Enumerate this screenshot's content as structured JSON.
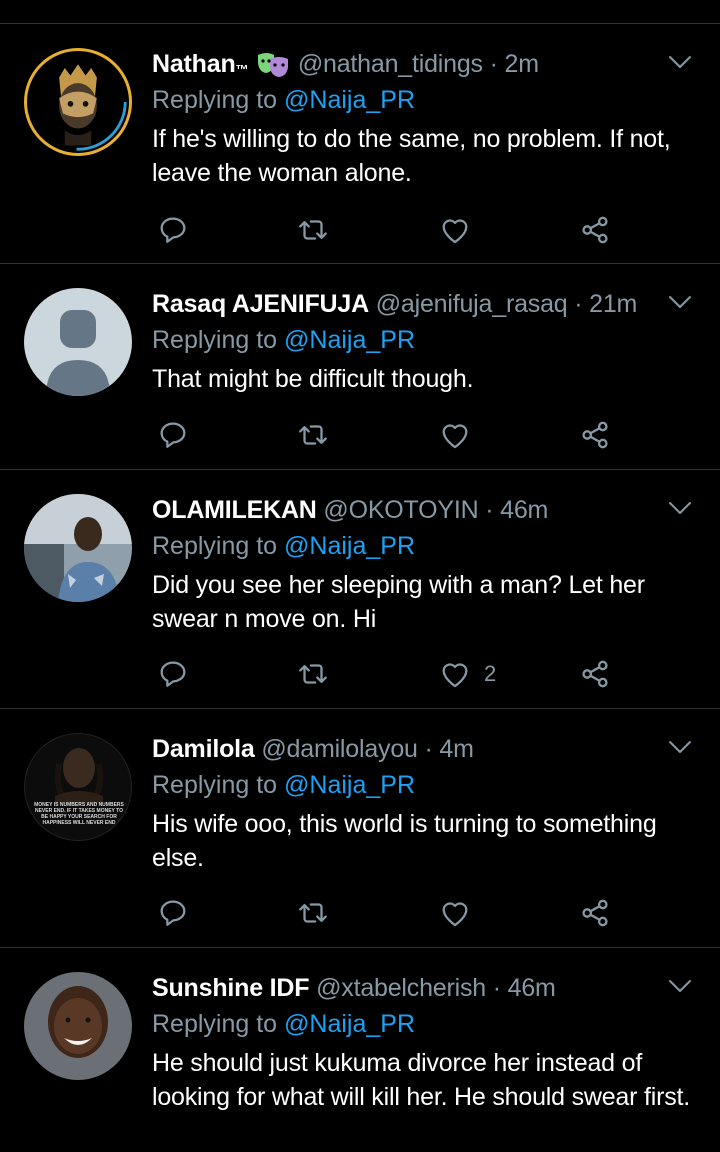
{
  "colors": {
    "background": "#000000",
    "muted": "#8899a6",
    "link": "#1da1f2",
    "divider": "#2f3336"
  },
  "tweets": [
    {
      "name": "Nathan",
      "trademark": "™",
      "emoji": "drama-masks-emoji",
      "handle": "@nathan_tidings",
      "sep": " · ",
      "time": "2m",
      "replying_prefix": "Replying to ",
      "replying_handle": "@Naija_PR",
      "text": "If he's willing to do the same, no problem. If not, leave the woman alone.",
      "likes": "",
      "avatar": "tiger-mask-portrait"
    },
    {
      "name": "Rasaq AJENIFUJA",
      "handle": "@ajenifuja_rasaq",
      "sep": " · ",
      "time": "21m",
      "replying_prefix": "Replying to ",
      "replying_handle": "@Naija_PR",
      "text": "That might be difficult though.",
      "likes": "",
      "avatar": "default-profile"
    },
    {
      "name": "OLAMILEKAN",
      "handle": "@OKOTOYIN",
      "sep": " · ",
      "time": "46m",
      "replying_prefix": "Replying to ",
      "replying_handle": "@Naija_PR",
      "text": "Did you see her sleeping with a man? Let her swear n move on. Hi",
      "likes": "2",
      "avatar": "man-in-car-photo"
    },
    {
      "name": "Damilola",
      "handle": "@damilolayou",
      "sep": " · ",
      "time": "4m",
      "replying_prefix": "Replying to ",
      "replying_handle": "@Naija_PR",
      "text": "His wife ooo, this world is turning to something else.",
      "likes": "",
      "avatar": "quote-image",
      "avatar_quote": "MONEY IS NUMBERS AND NUMBERS NEVER END. IF IT TAKES MONEY TO BE HAPPY YOUR SEARCH FOR HAPPINESS WILL NEVER END"
    },
    {
      "name": "Sunshine IDF",
      "handle": "@xtabelcherish",
      "sep": " · ",
      "time": "46m",
      "replying_prefix": "Replying to ",
      "replying_handle": "@Naija_PR",
      "text": "He should just kukuma divorce her instead of looking for what will kill her. He should swear first.",
      "likes": "",
      "avatar": "smiling-woman-photo"
    }
  ]
}
